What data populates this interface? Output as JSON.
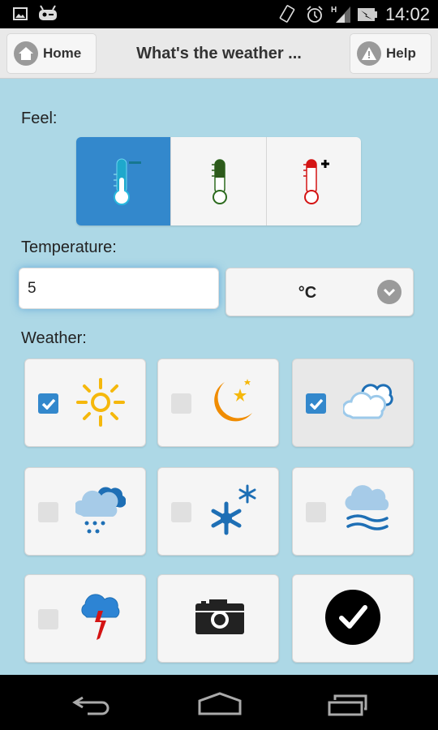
{
  "status_bar": {
    "time": "14:02",
    "icons": [
      "gallery-icon",
      "cyanogenmod-icon",
      "vibrate-icon",
      "alarm-icon",
      "signal-icon",
      "battery-charging-icon"
    ],
    "network_type": "H"
  },
  "header": {
    "home_label": "Home",
    "title": "What's the weather ...",
    "help_label": "Help"
  },
  "feel": {
    "label": "Feel:",
    "options": [
      {
        "name": "cold",
        "icon": "thermometer-minus-icon",
        "selected": true
      },
      {
        "name": "neutral",
        "icon": "thermometer-icon",
        "selected": false
      },
      {
        "name": "hot",
        "icon": "thermometer-plus-icon",
        "selected": false
      }
    ]
  },
  "temperature": {
    "label": "Temperature:",
    "value": "5",
    "unit": "°C"
  },
  "weather": {
    "label": "Weather:",
    "items": [
      {
        "name": "sunny",
        "icon": "sun-icon",
        "checked": true
      },
      {
        "name": "clear-night",
        "icon": "moon-stars-icon",
        "checked": false
      },
      {
        "name": "cloudy",
        "icon": "clouds-icon",
        "checked": true
      },
      {
        "name": "rain",
        "icon": "rain-cloud-icon",
        "checked": false
      },
      {
        "name": "snow",
        "icon": "snowflake-icon",
        "checked": false
      },
      {
        "name": "fog",
        "icon": "fog-icon",
        "checked": false
      },
      {
        "name": "thunderstorm",
        "icon": "storm-icon",
        "checked": false
      }
    ],
    "actions": [
      {
        "name": "camera",
        "icon": "camera-icon"
      },
      {
        "name": "submit",
        "icon": "checkmark-circle-icon"
      }
    ]
  },
  "colors": {
    "background": "#add8e6",
    "accent": "#3388cc",
    "tile": "#f5f5f5"
  },
  "nav_bar": {
    "buttons": [
      "back-icon",
      "home-icon",
      "recents-icon"
    ]
  }
}
